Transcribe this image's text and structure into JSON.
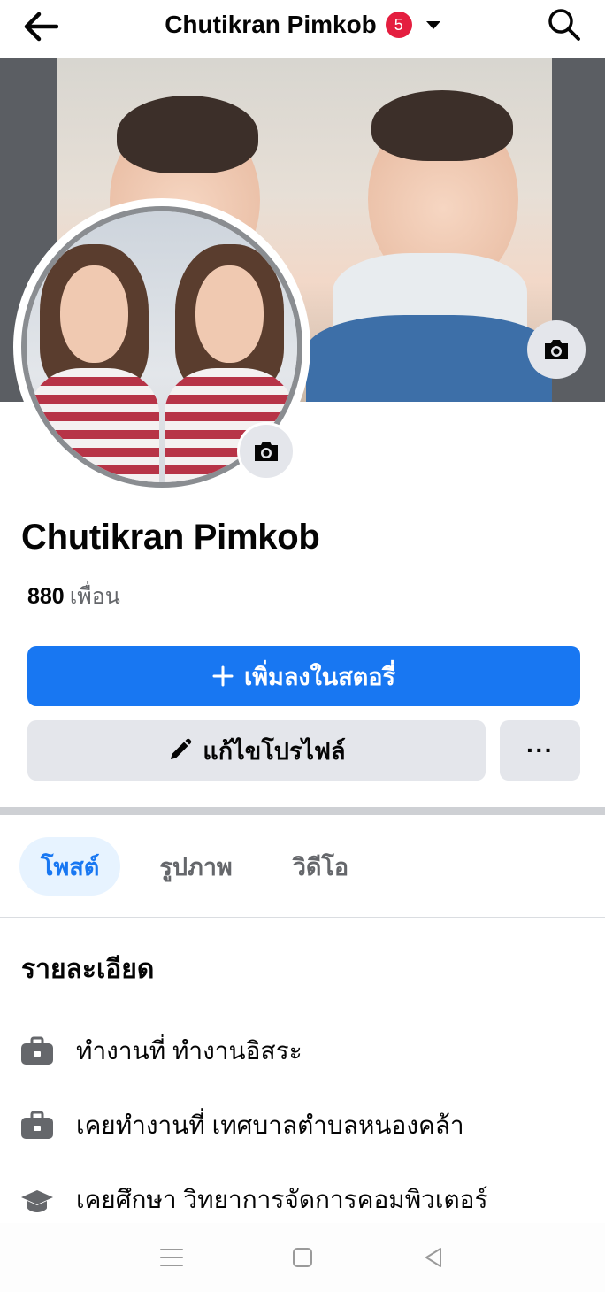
{
  "header": {
    "title": "Chutikran Pimkob",
    "notification_count": "5",
    "back_icon": "arrow-left-icon",
    "search_icon": "search-icon"
  },
  "profile": {
    "name": "Chutikran Pimkob",
    "friends_count": "880",
    "friends_label": "เพื่อน"
  },
  "actions": {
    "add_story": "เพิ่มลงในสตอรี่",
    "edit_profile": "แก้ไขโปรไฟล์",
    "more": "···"
  },
  "tabs": [
    {
      "label": "โพสต์",
      "active": true
    },
    {
      "label": "รูปภาพ",
      "active": false
    },
    {
      "label": "วิดีโอ",
      "active": false
    }
  ],
  "details": {
    "title": "รายละเอียด",
    "items": [
      {
        "icon": "briefcase-icon",
        "text": "ทำงานที่ ทำงานอิสระ"
      },
      {
        "icon": "briefcase-icon",
        "text": "เคยทำงานที่ เทศบาลตำบลหนองคล้า"
      },
      {
        "icon": "graduation-cap-icon",
        "text": "เคยศึกษา วิทยาการจัดการคอมพิวเตอร์"
      }
    ]
  },
  "colors": {
    "primary": "#1877f2",
    "badge": "#e41e3f",
    "secondary_button": "#e4e6eb",
    "muted_text": "#65676b"
  }
}
